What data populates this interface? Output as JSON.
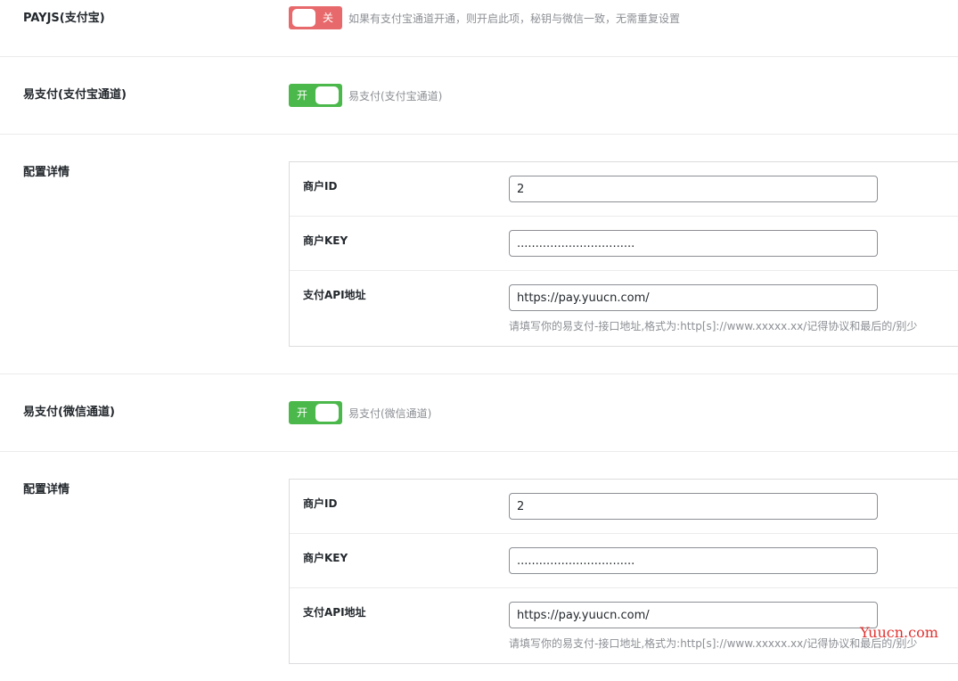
{
  "payjs_alipay": {
    "label": "PAYJS(支付宝)",
    "toggle_state": "off",
    "toggle_text": "关",
    "description": "如果有支付宝通道开通，则开启此项，秘钥与微信一致，无需重复设置"
  },
  "epay_alipay": {
    "label": "易支付(支付宝通道)",
    "toggle_state": "on",
    "toggle_text": "开",
    "description": "易支付(支付宝通道)"
  },
  "epay_alipay_config": {
    "label": "配置详情",
    "merchant_id_label": "商户ID",
    "merchant_id_value": "2",
    "merchant_key_label": "商户KEY",
    "merchant_key_value": "................................",
    "api_url_label": "支付API地址",
    "api_url_value": "https://pay.yuucn.com/",
    "api_url_hint": "请填写你的易支付-接口地址,格式为:http[s]://www.xxxxx.xx/记得协议和最后的/别少"
  },
  "epay_wechat": {
    "label": "易支付(微信通道)",
    "toggle_state": "on",
    "toggle_text": "开",
    "description": "易支付(微信通道)"
  },
  "epay_wechat_config": {
    "label": "配置详情",
    "merchant_id_label": "商户ID",
    "merchant_id_value": "2",
    "merchant_key_label": "商户KEY",
    "merchant_key_value": "................................",
    "api_url_label": "支付API地址",
    "api_url_value": "https://pay.yuucn.com/",
    "api_url_hint": "请填写你的易支付-接口地址,格式为:http[s]://www.xxxxx.xx/记得协议和最后的/别少"
  },
  "watermark": "Yuucn.com",
  "colors": {
    "toggle_off": "#e8696b",
    "toggle_on": "#4bb84b",
    "watermark": "#e0312f"
  }
}
